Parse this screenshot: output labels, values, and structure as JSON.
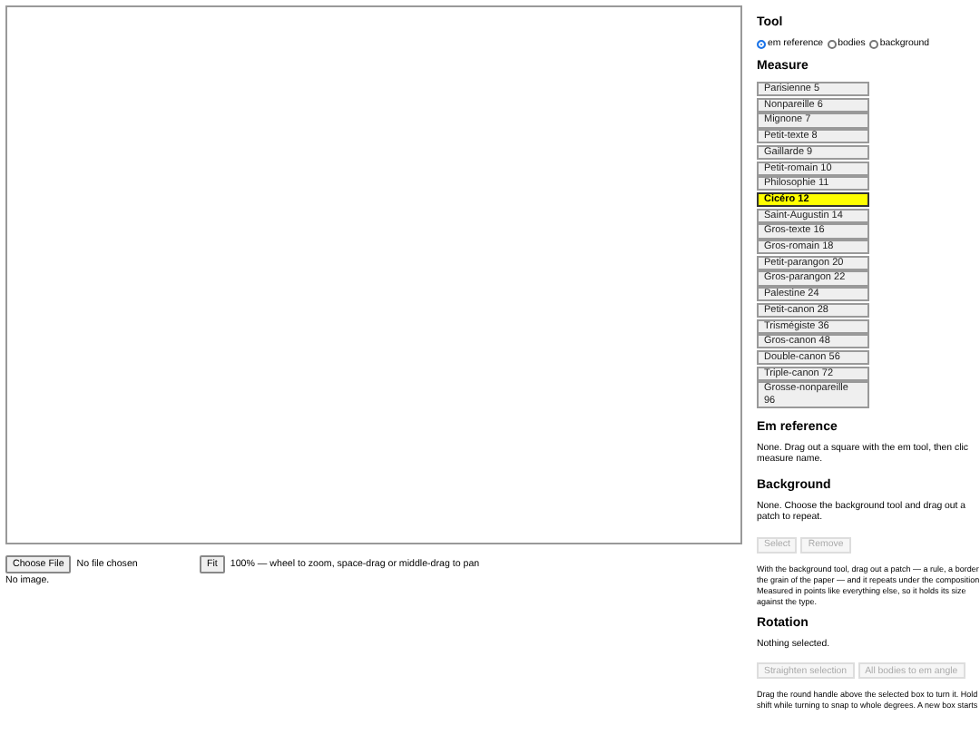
{
  "canvas": {
    "file_button": "Choose File",
    "file_status": "No file chosen",
    "fit_button": "Fit",
    "zoom_hint": "100% — wheel to zoom, space-drag or middle-drag to pan",
    "image_status": "No image."
  },
  "sidebar": {
    "tool": {
      "heading": "Tool",
      "options": [
        {
          "label": "em reference",
          "selected": true
        },
        {
          "label": "bodies",
          "selected": false
        },
        {
          "label": "background",
          "selected": false
        }
      ]
    },
    "measure": {
      "heading": "Measure",
      "items": [
        {
          "label": "Parisienne 5",
          "selected": false
        },
        {
          "label": "Nonpareille 6",
          "selected": false
        },
        {
          "label": "Mignone 7",
          "selected": false
        },
        {
          "label": "Petit-texte 8",
          "selected": false
        },
        {
          "label": "Gaillarde 9",
          "selected": false
        },
        {
          "label": "Petit-romain 10",
          "selected": false
        },
        {
          "label": "Philosophie 11",
          "selected": false
        },
        {
          "label": "Cicéro 12",
          "selected": true
        },
        {
          "label": "Saint-Augustin 14",
          "selected": false
        },
        {
          "label": "Gros-texte 16",
          "selected": false
        },
        {
          "label": "Gros-romain 18",
          "selected": false
        },
        {
          "label": "Petit-parangon 20",
          "selected": false
        },
        {
          "label": "Gros-parangon 22",
          "selected": false
        },
        {
          "label": "Palestine 24",
          "selected": false
        },
        {
          "label": "Petit-canon 28",
          "selected": false
        },
        {
          "label": "Trismégiste 36",
          "selected": false
        },
        {
          "label": "Gros-canon 48",
          "selected": false
        },
        {
          "label": "Double-canon 56",
          "selected": false
        },
        {
          "label": "Triple-canon 72",
          "selected": false
        },
        {
          "label": "Grosse-nonpareille 96",
          "selected": false
        }
      ]
    },
    "em_reference": {
      "heading": "Em reference",
      "text_lines": [
        "None. Drag out a square with the em tool, then clic",
        "measure name."
      ]
    },
    "background": {
      "heading": "Background",
      "text_lines": [
        "None. Choose the background tool and drag out a",
        "patch to repeat."
      ],
      "buttons": [
        {
          "label": "Select",
          "disabled": true
        },
        {
          "label": "Remove",
          "disabled": true
        }
      ],
      "help_lines": [
        "With the background tool, drag out a patch — a rule, a border",
        "the grain of the paper — and it repeats under the composition",
        "Measured in points like everything else, so it holds its size",
        "against the type."
      ]
    },
    "rotation": {
      "heading": "Rotation",
      "status": "Nothing selected.",
      "buttons": [
        {
          "label": "Straighten selection",
          "disabled": true
        },
        {
          "label": "All bodies to em angle",
          "disabled": true
        }
      ],
      "help_lines": [
        "Drag the round handle above the selected box to turn it. Hold",
        "shift while turning to snap to whole degrees. A new box starts"
      ]
    }
  }
}
